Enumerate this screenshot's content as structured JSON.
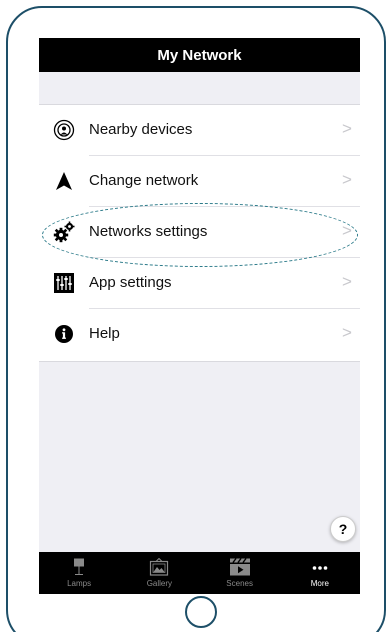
{
  "header": {
    "title": "My Network"
  },
  "menu": {
    "items": [
      {
        "label": "Nearby devices",
        "icon": "nearby-devices-icon"
      },
      {
        "label": "Change network",
        "icon": "navigation-arrow-icon"
      },
      {
        "label": "Networks settings",
        "icon": "gears-icon"
      },
      {
        "label": "App settings",
        "icon": "sliders-icon"
      },
      {
        "label": "Help",
        "icon": "info-icon"
      }
    ],
    "chevron": ">"
  },
  "help_fab": {
    "label": "?"
  },
  "tabbar": {
    "tabs": [
      {
        "label": "Lamps",
        "icon": "lamp-icon",
        "active": false
      },
      {
        "label": "Gallery",
        "icon": "gallery-icon",
        "active": false
      },
      {
        "label": "Scenes",
        "icon": "clapperboard-icon",
        "active": false
      },
      {
        "label": "More",
        "icon": "more-dots-icon",
        "active": true
      }
    ]
  },
  "colors": {
    "device_frame": "#1d4f68",
    "highlight": "#2b7a89",
    "navbar_bg": "#000000",
    "list_bg": "#ffffff",
    "screen_bg": "#efeff4"
  }
}
